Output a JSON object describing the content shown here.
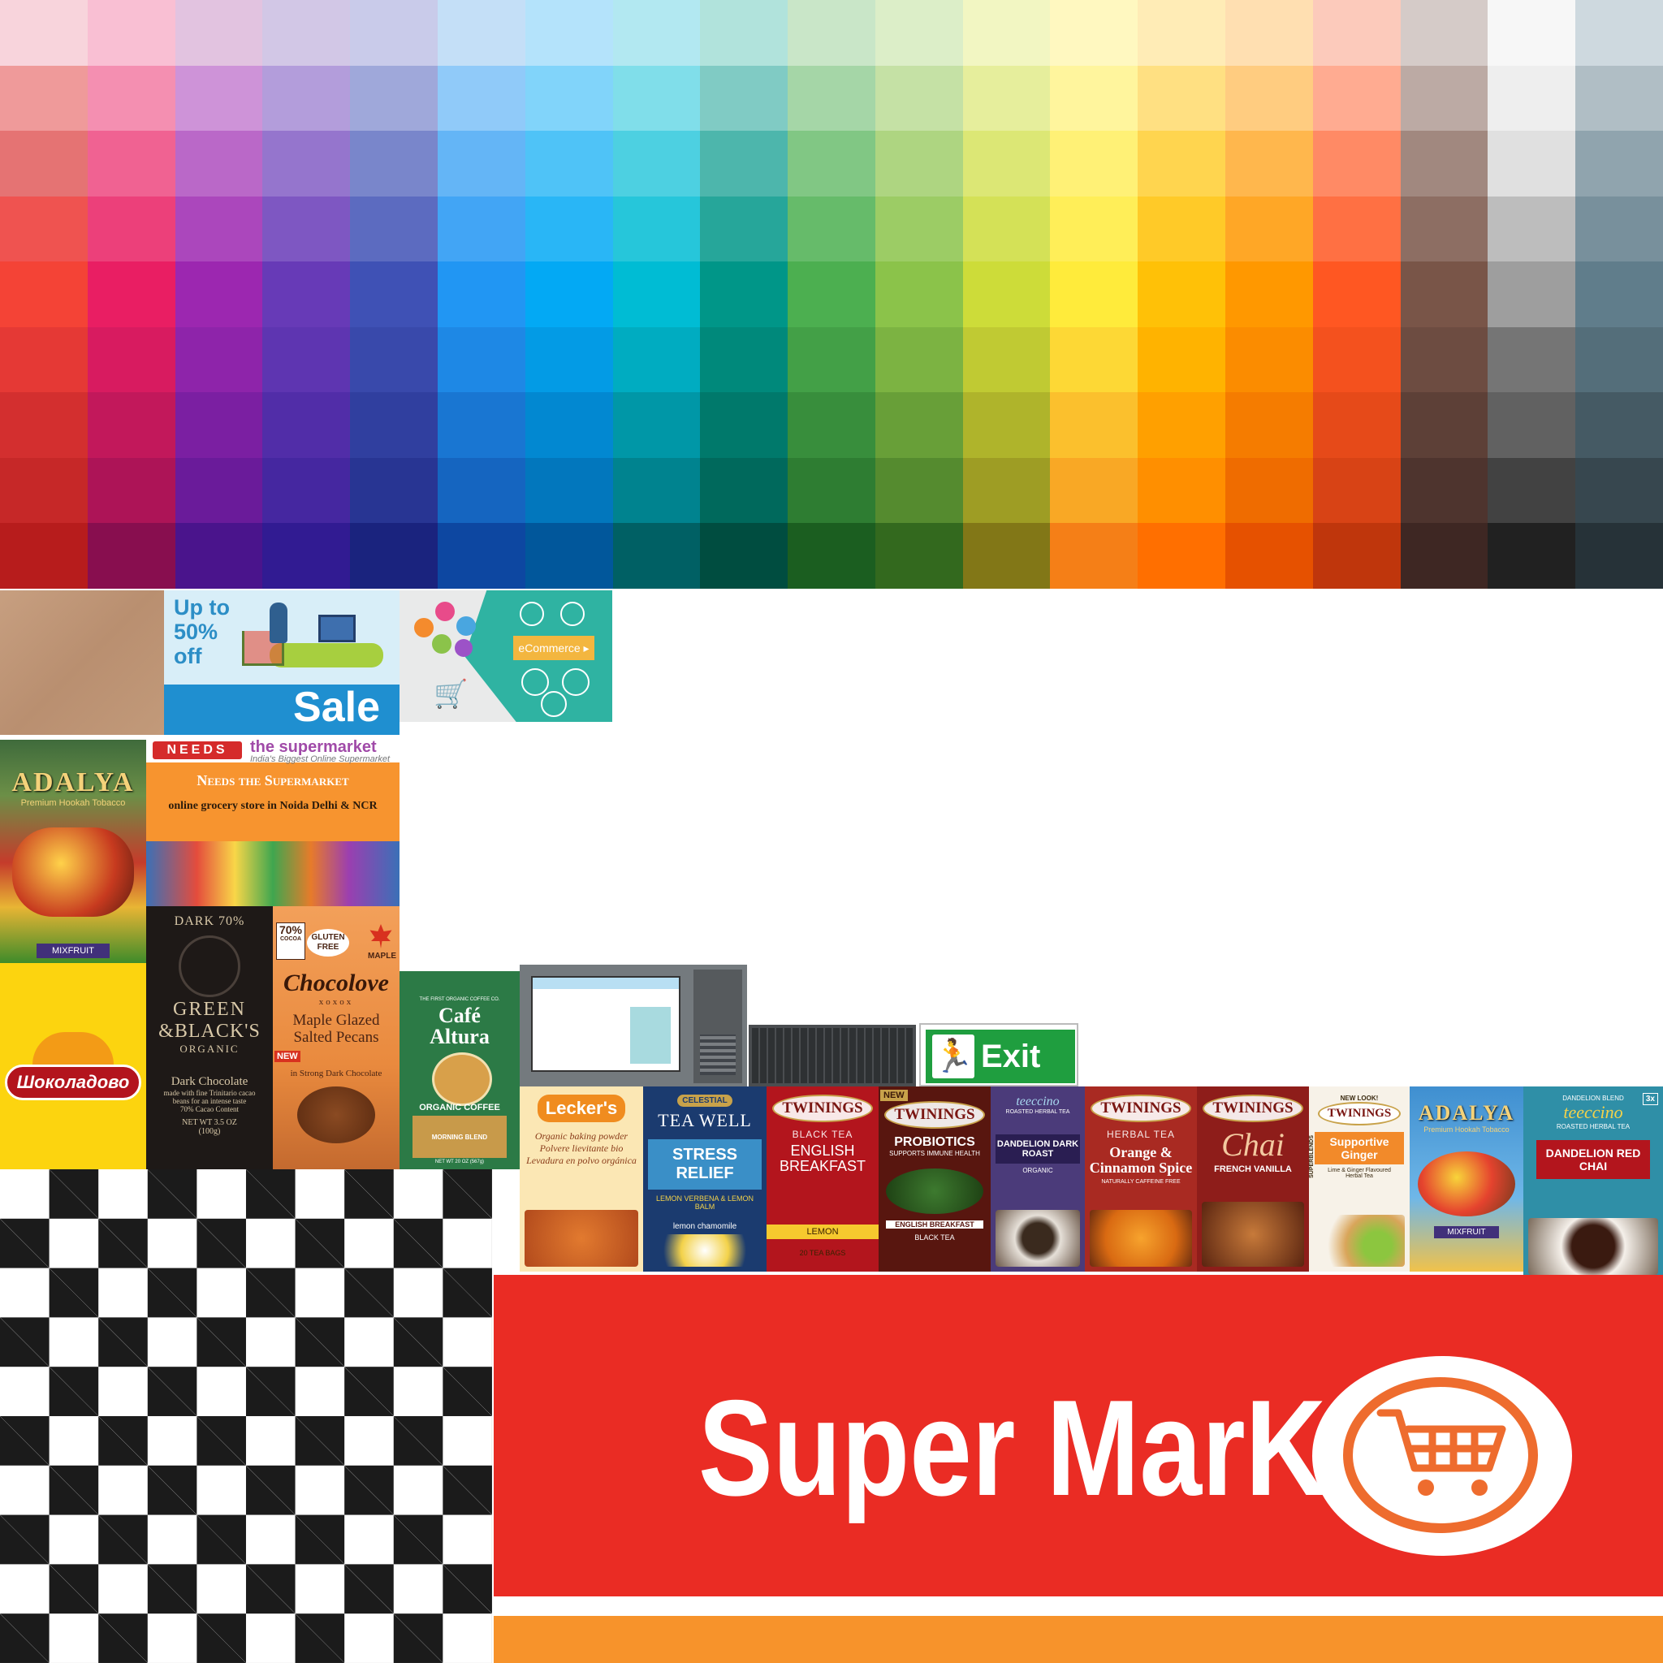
{
  "palette": {
    "rows": 9,
    "cols": 19,
    "colors": [
      [
        "#f8d4dc",
        "#f9bfd3",
        "#e2c3e0",
        "#d2c7e6",
        "#c9cbea",
        "#c4dff7",
        "#b4e3fb",
        "#b2e8f1",
        "#b1e3dc",
        "#c9e6c8",
        "#dceec8",
        "#f2f6c2",
        "#fff8c0",
        "#ffecb6",
        "#ffdfb1",
        "#fccabb",
        "#d5cbc8",
        "#f7f7f7",
        "#ced9df"
      ],
      [
        "#ef9a9a",
        "#f48fb1",
        "#ce93d8",
        "#b39ddb",
        "#9fa8da",
        "#90caf9",
        "#81d4fa",
        "#80deea",
        "#80cbc4",
        "#a5d6a7",
        "#c5e1a5",
        "#e6ee9c",
        "#fff59d",
        "#ffe082",
        "#ffcc80",
        "#ffab91",
        "#bcaaa4",
        "#eeeeee",
        "#b0bec5"
      ],
      [
        "#e57373",
        "#f06292",
        "#ba68c8",
        "#9575cd",
        "#7986cb",
        "#64b5f6",
        "#4fc3f7",
        "#4dd0e1",
        "#4db6ac",
        "#81c784",
        "#aed581",
        "#dce775",
        "#fff176",
        "#ffd54f",
        "#ffb74d",
        "#ff8a65",
        "#a1887f",
        "#e0e0e0",
        "#90a4ae"
      ],
      [
        "#ef5350",
        "#ec407a",
        "#ab47bc",
        "#7e57c2",
        "#5c6bc0",
        "#42a5f5",
        "#29b6f6",
        "#26c6da",
        "#26a69a",
        "#66bb6a",
        "#9ccc65",
        "#d4e157",
        "#ffee58",
        "#ffca28",
        "#ffa726",
        "#ff7043",
        "#8d6e63",
        "#bdbdbd",
        "#78909c"
      ],
      [
        "#f44336",
        "#e91e63",
        "#9c27b0",
        "#673ab7",
        "#3f51b5",
        "#2196f3",
        "#03a9f4",
        "#00bcd4",
        "#009688",
        "#4caf50",
        "#8bc34a",
        "#cddc39",
        "#ffeb3b",
        "#ffc107",
        "#ff9800",
        "#ff5722",
        "#795548",
        "#9e9e9e",
        "#607d8b"
      ],
      [
        "#e53935",
        "#d81b60",
        "#8e24aa",
        "#5e35b1",
        "#3949ab",
        "#1e88e5",
        "#039be5",
        "#00acc1",
        "#00897b",
        "#43a047",
        "#7cb342",
        "#c0ca33",
        "#fdd835",
        "#ffb300",
        "#fb8c00",
        "#f4511e",
        "#6d4c41",
        "#757575",
        "#546e7a"
      ],
      [
        "#d32f2f",
        "#c2185b",
        "#7b1fa2",
        "#512da8",
        "#303f9f",
        "#1976d2",
        "#0288d1",
        "#0097a7",
        "#00796b",
        "#388e3c",
        "#689f38",
        "#afb42b",
        "#fbc02d",
        "#ffa000",
        "#f57c00",
        "#e64a19",
        "#5d4037",
        "#616161",
        "#455a64"
      ],
      [
        "#c62828",
        "#ad1457",
        "#6a1b9a",
        "#4527a0",
        "#283593",
        "#1565c0",
        "#0277bd",
        "#00838f",
        "#00695c",
        "#2e7d32",
        "#558b2f",
        "#9e9d24",
        "#f9a825",
        "#ff8f00",
        "#ef6c00",
        "#d84315",
        "#4e342e",
        "#424242",
        "#37474f"
      ],
      [
        "#b71c1c",
        "#880e4f",
        "#4a148c",
        "#311b92",
        "#1a237e",
        "#0d47a1",
        "#01579b",
        "#006064",
        "#004d40",
        "#1b5e20",
        "#33691e",
        "#827717",
        "#f57f17",
        "#ff6f00",
        "#e65100",
        "#bf360c",
        "#3e2723",
        "#212121",
        "#263238"
      ]
    ]
  },
  "sale_banner": {
    "line1": "Up to",
    "line2": "50%",
    "line3": "off",
    "word": "Sale"
  },
  "ecommerce_banner": {
    "label": "eCommerce"
  },
  "adalya_top": {
    "brand": "ADALYA",
    "tagline": "Premium Hookah Tobacco",
    "flavor": "MIXFRUIT"
  },
  "needs_banner": {
    "badge": "NEEDS",
    "site": "the supermarket",
    "subtitle": "India's Biggest Online Supermarket",
    "heading": "Needs the Supermarket",
    "tagline": "online grocery store in Noida Delhi & NCR"
  },
  "shokoladovo": {
    "brand": "Шоколадово"
  },
  "green_blacks": {
    "percent": "DARK 70%",
    "brand1": "GREEN",
    "brand2": "&BLACK'S",
    "organic": "ORGANIC",
    "product": "Dark Chocolate",
    "desc": "made with fine Trinitario cacao beans for an intense taste",
    "cocoa": "70% Cacao Content",
    "weight": "NET WT 3.5 OZ (100g)"
  },
  "chocolove": {
    "percent": "70%",
    "percent_sub": "COCOA",
    "badge": "GLUTEN FREE",
    "maple": "MAPLE",
    "brand": "Chocolove",
    "kisses": "xoxox",
    "flavor": "Maple Glazed Salted Pecans",
    "desc": "in Strong Dark Chocolate",
    "new": "NEW"
  },
  "cafe_altura": {
    "top": "THE FIRST ORGANIC COFFEE CO.",
    "brand1": "Café",
    "brand2": "Altura",
    "type": "ORGANIC COFFEE",
    "blend": "MORNING BLEND",
    "weight": "NET WT 20 OZ (567g)"
  },
  "exit_sign": {
    "label": "Exit"
  },
  "products": [
    {
      "brand": "Lecker's",
      "line1": "Organic baking powder",
      "line2": "Polvere lievitante bio",
      "line3": "Levadura en polvo orgánica"
    },
    {
      "brand": "CELESTIAL",
      "line1": "TEA WELL",
      "title": "STRESS RELIEF",
      "sub": "LEMON VERBENA & LEMON BALM",
      "extra": "lemon chamomile"
    },
    {
      "brand": "TWININGS",
      "line1": "BLACK TEA",
      "title": "ENGLISH BREAKFAST",
      "sub": "LEMON",
      "extra": "20 TEA BAGS"
    },
    {
      "brand": "TWININGS",
      "line1": "NEW",
      "title": "PROBIOTICS",
      "sub": "SUPPORTS IMMUNE HEALTH",
      "extra": "ENGLISH BREAKFAST",
      "extra2": "BLACK TEA"
    },
    {
      "brand": "teeccino",
      "line1": "ROASTED HERBAL TEA",
      "title": "DANDELION DARK ROAST",
      "sub": "ORGANIC"
    },
    {
      "brand": "TWININGS",
      "line1": "HERBAL TEA",
      "title": "Orange & Cinnamon Spice",
      "sub": "NATURALLY CAFFEINE FREE"
    },
    {
      "brand": "TWININGS",
      "line1": "",
      "title": "Chai",
      "sub": "FRENCH VANILLA"
    },
    {
      "brand": "TWININGS",
      "line1": "NEW LOOK!",
      "title": "Supportive Ginger",
      "sub": "Lime & Ginger Flavoured Herbal Tea",
      "extra": "SUPERBLENDS"
    },
    {
      "brand": "ADALYA",
      "line1": "Premium Hookah Tobacco",
      "title": "",
      "sub": "MIXFRUIT"
    },
    {
      "brand": "teeccino",
      "line1": "DANDELION BLEND",
      "title": "DANDELION RED CHAI",
      "sub": "ROASTED HERBAL TEA",
      "extra": "3x"
    }
  ],
  "supermarket_banner": {
    "title": "Super MarKet"
  }
}
